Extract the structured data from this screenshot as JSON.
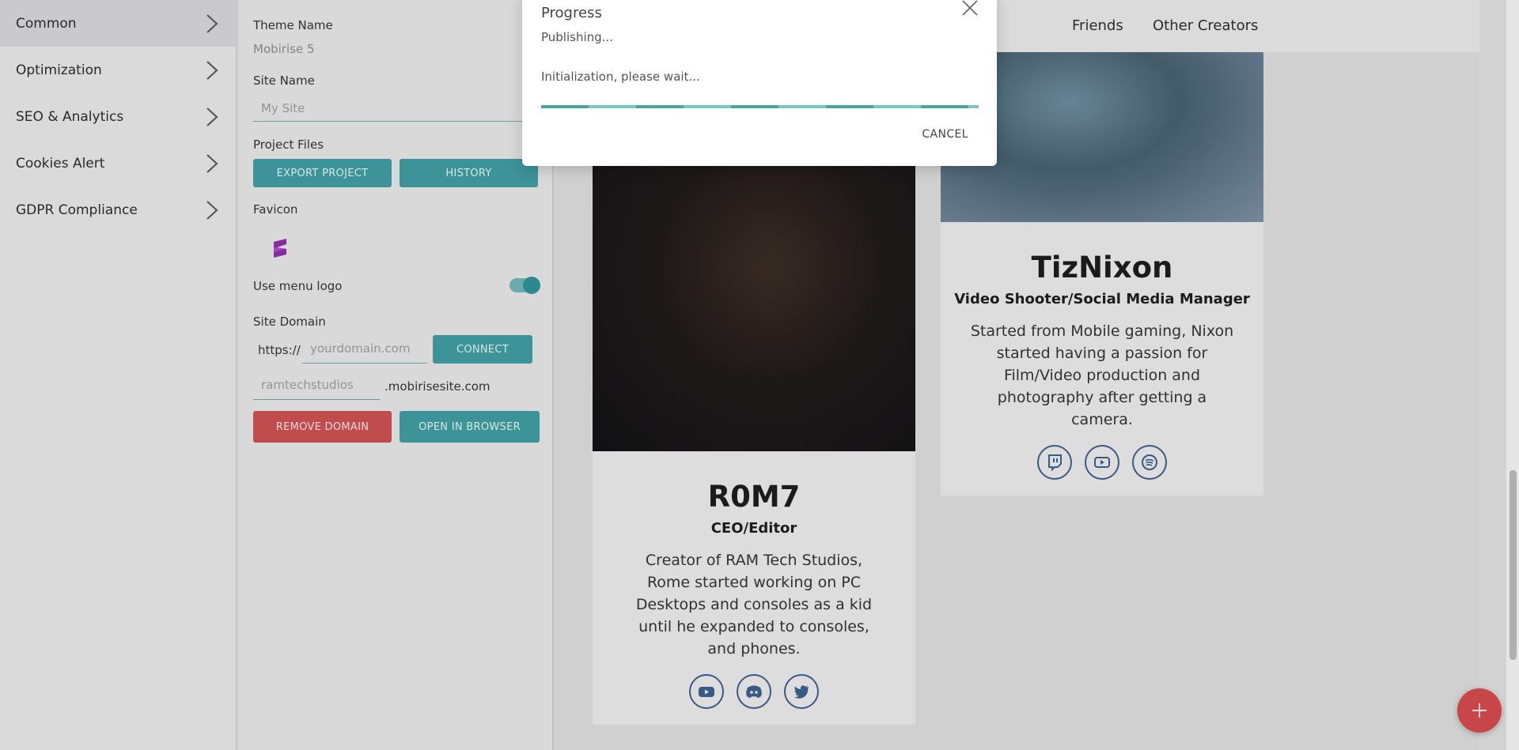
{
  "sidebar": {
    "items": [
      {
        "label": "Common"
      },
      {
        "label": "Optimization"
      },
      {
        "label": "SEO & Analytics"
      },
      {
        "label": "Cookies Alert"
      },
      {
        "label": "GDPR Compliance"
      }
    ]
  },
  "panel": {
    "theme_name_label": "Theme Name",
    "theme_name_value": "Mobirise 5",
    "site_name_label": "Site Name",
    "site_name_placeholder": "My Site",
    "project_files_label": "Project Files",
    "export_project": "EXPORT PROJECT",
    "history": "HISTORY",
    "favicon_label": "Favicon",
    "use_menu_logo_label": "Use menu logo",
    "use_menu_logo_on": true,
    "site_domain_label": "Site Domain",
    "https_prefix": "https://",
    "domain_placeholder": "yourdomain.com",
    "connect": "CONNECT",
    "subdomain_value": "ramtechstudios",
    "subdomain_suffix": ".mobirisesite.com",
    "remove_domain": "REMOVE DOMAIN",
    "open_in_browser": "OPEN IN BROWSER"
  },
  "preview": {
    "nav": [
      "Friends",
      "Other Creators"
    ],
    "cards": [
      {
        "name": "R0M7",
        "role": "CEO/Editor",
        "desc": "Creator of RAM Tech Studios, Rome started working on PC Desktops and consoles as a kid until he expanded to consoles, and phones.",
        "socials": [
          "youtube-icon",
          "discord-icon",
          "twitter-icon"
        ]
      },
      {
        "name": "TizNixon",
        "role": "Video Shooter/Social Media Manager",
        "desc": "Started from Mobile gaming, Nixon started having a passion for Film/Video production and photography after getting a camera.",
        "socials": [
          "twitch-icon",
          "youtube-icon",
          "spotify-icon"
        ]
      }
    ]
  },
  "dialog": {
    "title": "Progress",
    "status": "Publishing...",
    "detail": "Initialization, please wait...",
    "cancel": "CANCEL",
    "progress_fraction": 1.0
  },
  "colors": {
    "accent": "#3f9a9f",
    "danger": "#c95052",
    "fab": "#c84648",
    "social": "#3b5e8a"
  }
}
